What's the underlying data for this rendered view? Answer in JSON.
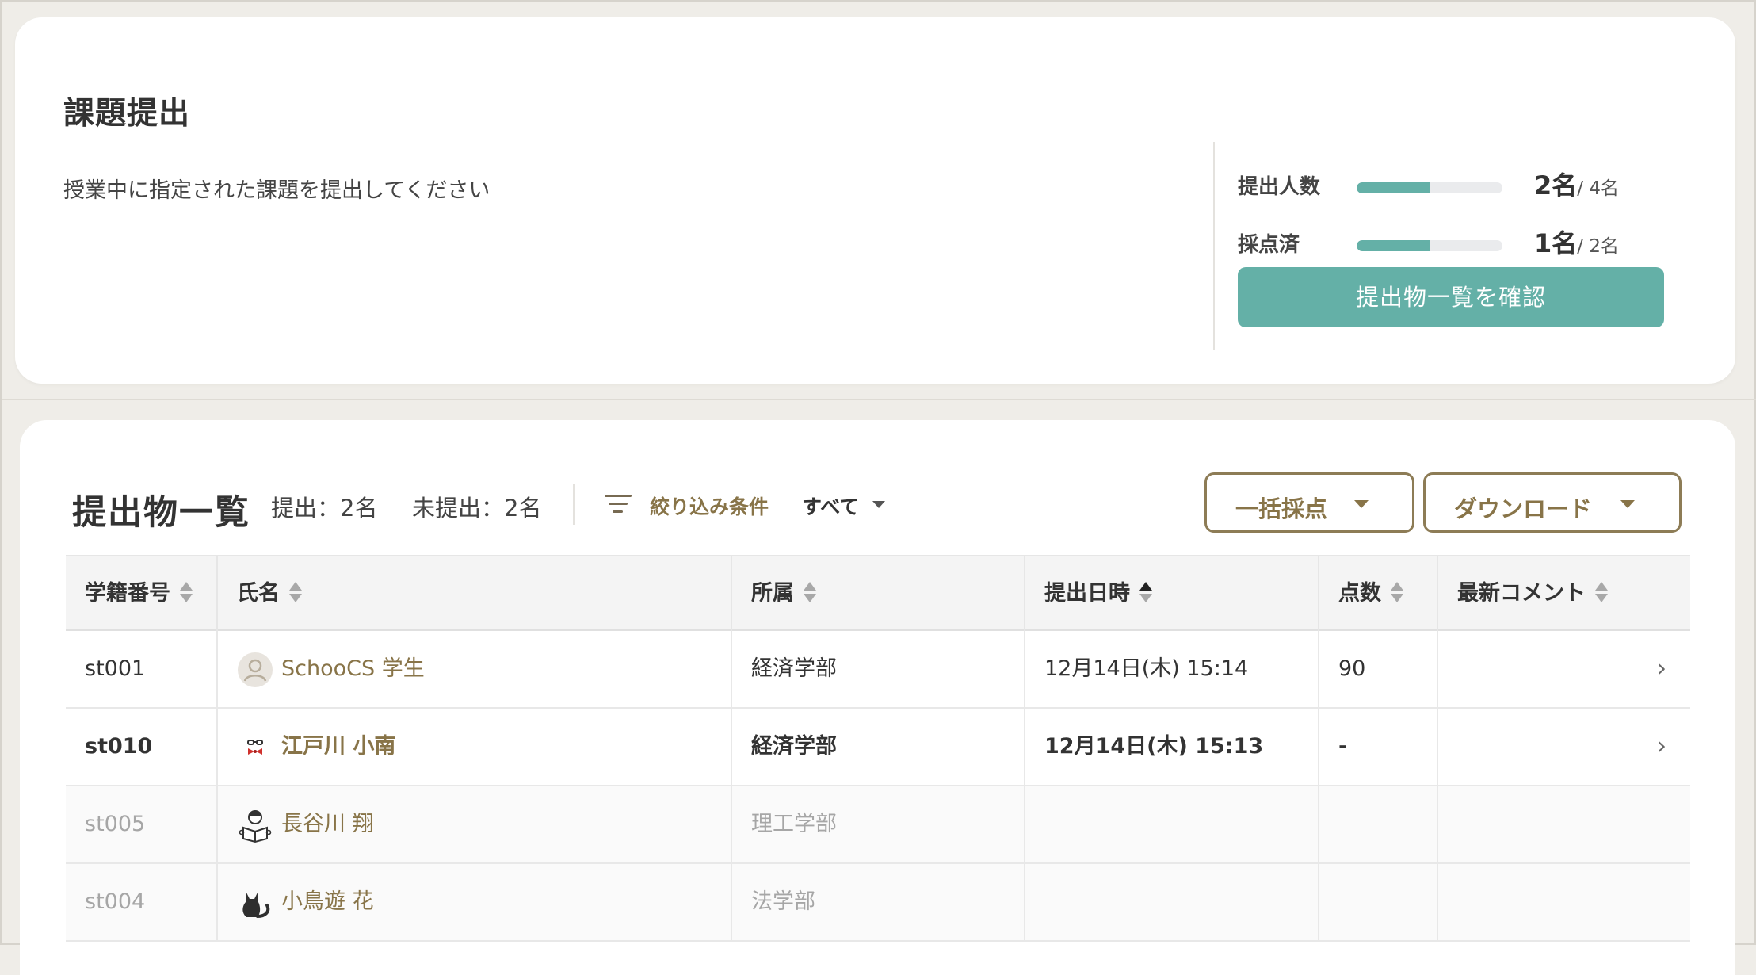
{
  "assignment": {
    "title": "課題提出",
    "description": "授業中に指定された課題を提出してください",
    "stats": [
      {
        "label": "提出人数",
        "count": "2名",
        "total": "/ 4名",
        "fraction": 0.5
      },
      {
        "label": "採点済",
        "count": "1名",
        "total": "/ 2名",
        "fraction": 0.5
      }
    ],
    "confirm_button": "提出物一覧を確認"
  },
  "submissions": {
    "title": "提出物一覧",
    "submitted_label": "提出：2名",
    "unsubmitted_label": "未提出：2名",
    "filter_label": "絞り込み条件",
    "filter_value": "すべて",
    "bulk_grade_button": "一括採点",
    "download_button": "ダウンロード",
    "columns": [
      "学籍番号",
      "氏名",
      "所属",
      "提出日時",
      "点数",
      "最新コメント"
    ],
    "rows": [
      {
        "id": "st001",
        "name": "SchooCS 学生",
        "dept": "経済学部",
        "date": "12月14日(木) 15:14",
        "score": "90",
        "comment": "",
        "chevron": "›"
      },
      {
        "id": "st010",
        "name": "江戸川 小南",
        "dept": "経済学部",
        "date": "12月14日(木) 15:13",
        "score": "-",
        "comment": "",
        "chevron": "›"
      },
      {
        "id": "st005",
        "name": "長谷川 翔",
        "dept": "理工学部",
        "date": "",
        "score": "",
        "comment": "",
        "chevron": ""
      },
      {
        "id": "st004",
        "name": "小鳥遊 花",
        "dept": "法学部",
        "date": "",
        "score": "",
        "comment": "",
        "chevron": ""
      }
    ]
  },
  "colors": {
    "accent": "#64b0a7",
    "brand_brown": "#887448",
    "background": "#efede8"
  },
  "icons": {
    "filter": "filter-icon",
    "sort": "sort-icon",
    "chevron": "chevron-right-icon"
  }
}
